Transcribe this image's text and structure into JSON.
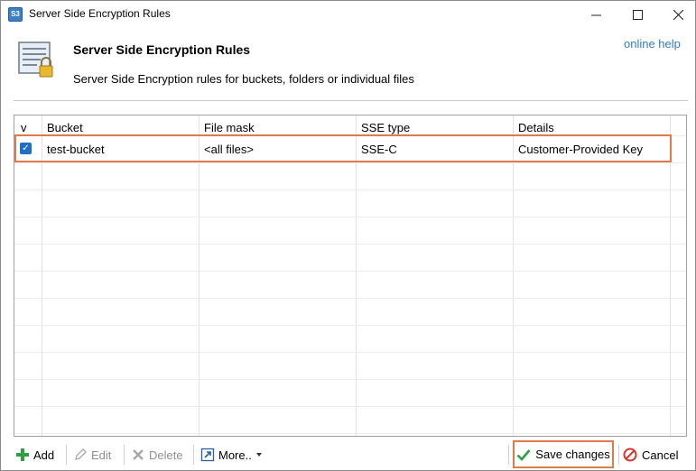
{
  "window": {
    "title": "Server Side Encryption Rules",
    "app_icon_text": "S3"
  },
  "header": {
    "title": "Server Side Encryption Rules",
    "subtitle": "Server Side Encryption rules for buckets, folders or individual files",
    "help_link": "online help"
  },
  "grid": {
    "columns": [
      "v",
      "Bucket",
      "File mask",
      "SSE type",
      "Details"
    ],
    "rows": [
      {
        "checked": true,
        "bucket": "test-bucket",
        "file_mask": "<all files>",
        "sse_type": "SSE-C",
        "details": "Customer-Provided Key"
      }
    ]
  },
  "toolbar": {
    "add_label": "Add",
    "edit_label": "Edit",
    "delete_label": "Delete",
    "more_label": "More..",
    "save_label": "Save changes",
    "cancel_label": "Cancel"
  },
  "colors": {
    "highlight": "#e07a4a",
    "link": "#2e7ec6",
    "checkbox": "#1f6fc8",
    "add_green": "#2ea043",
    "cancel_red": "#d9342b"
  }
}
